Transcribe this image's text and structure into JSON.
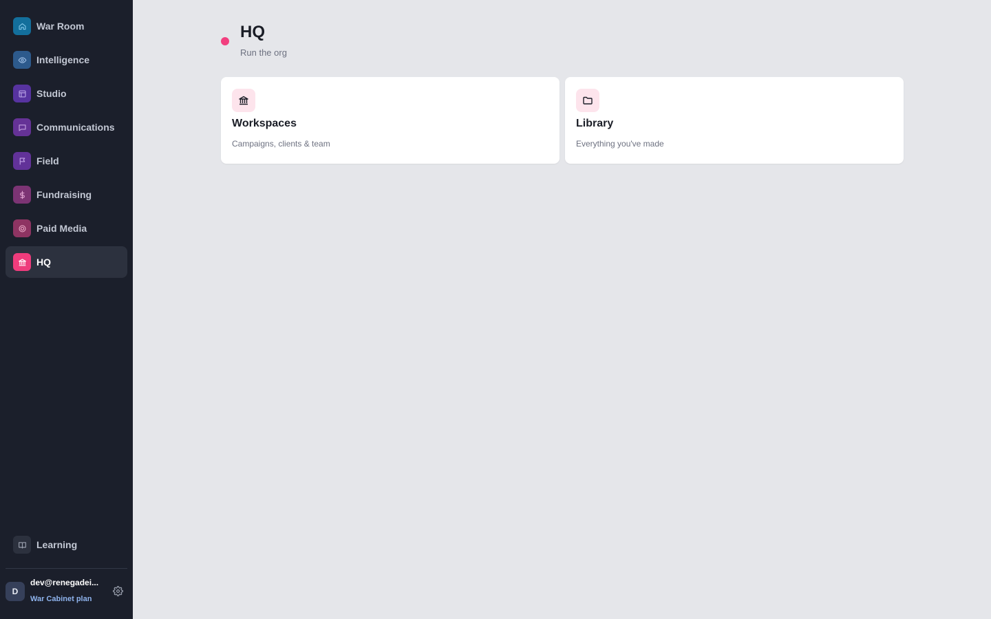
{
  "sidebar": {
    "items": [
      {
        "label": "War Room",
        "icon": "home-icon",
        "color": "#136f9c",
        "active": false
      },
      {
        "label": "Intelligence",
        "icon": "eye-icon",
        "color": "#2d5a8c",
        "active": false
      },
      {
        "label": "Studio",
        "icon": "layout-icon",
        "color": "#5733a0",
        "active": false
      },
      {
        "label": "Communications",
        "icon": "message-icon",
        "color": "#653296",
        "active": false
      },
      {
        "label": "Field",
        "icon": "flag-icon",
        "color": "#623299",
        "active": false
      },
      {
        "label": "Fundraising",
        "icon": "dollar-icon",
        "color": "#7c3474",
        "active": false
      },
      {
        "label": "Paid Media",
        "icon": "target-icon",
        "color": "#8e3462",
        "active": false
      },
      {
        "label": "HQ",
        "icon": "bank-icon",
        "color": "#ee3c7c",
        "active": true
      }
    ],
    "learning": {
      "label": "Learning",
      "icon": "book-icon",
      "color": "#2c313e"
    },
    "user": {
      "avatar_initial": "D",
      "email": "dev@renegadei...",
      "plan": "War Cabinet plan"
    }
  },
  "main": {
    "title": "HQ",
    "subtitle": "Run the org",
    "accent": "#f23f7f",
    "cards": [
      {
        "title": "Workspaces",
        "subtitle": "Campaigns, clients & team",
        "icon": "bank-icon"
      },
      {
        "title": "Library",
        "subtitle": "Everything you've made",
        "icon": "folder-icon"
      }
    ]
  }
}
